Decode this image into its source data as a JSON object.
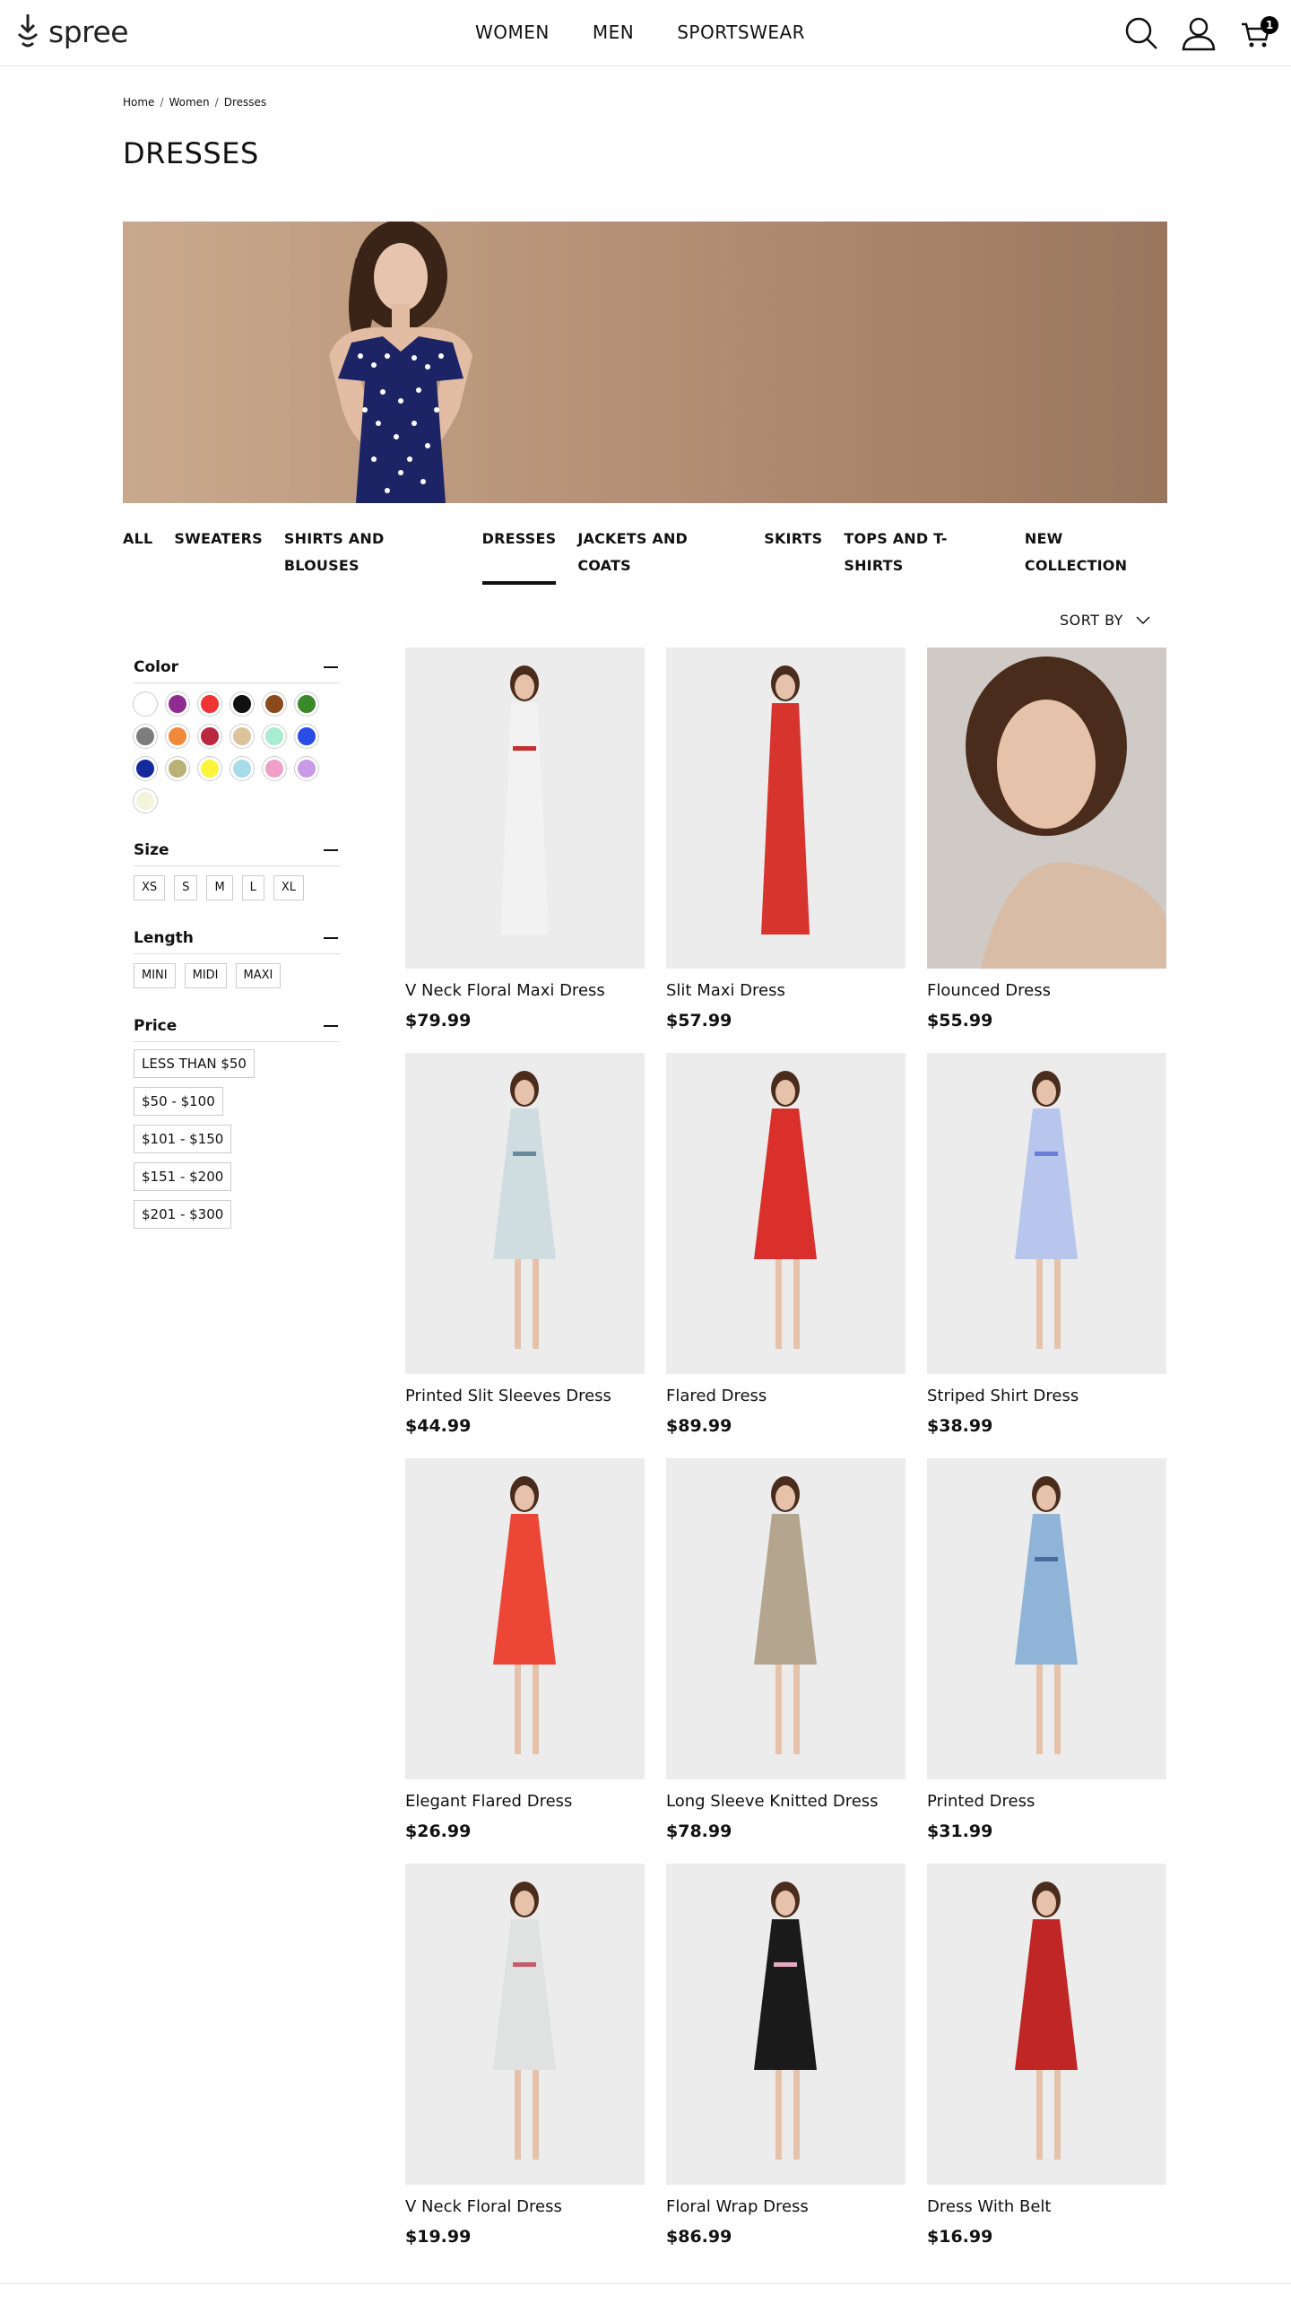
{
  "header": {
    "logo_text": "spree",
    "nav": [
      "WOMEN",
      "MEN",
      "SPORTSWEAR"
    ],
    "cart_count": "1",
    "icons": [
      "search-icon",
      "account-icon",
      "cart-icon"
    ]
  },
  "breadcrumb": [
    "Home",
    "Women",
    "Dresses"
  ],
  "page_title": "DRESSES",
  "categories": [
    "ALL",
    "SWEATERS",
    "SHIRTS AND BLOUSES",
    "DRESSES",
    "JACKETS AND COATS",
    "SKIRTS",
    "TOPS AND T-SHIRTS",
    "NEW COLLECTION"
  ],
  "active_category": "DRESSES",
  "sort_label": "SORT BY",
  "filters": {
    "color_title": "Color",
    "colors": [
      "#ffffff",
      "#8e2d8f",
      "#ee3434",
      "#111111",
      "#8a4a1c",
      "#3a8a2a",
      "#7d7d7d",
      "#f0893a",
      "#b8283e",
      "#dcc39b",
      "#a8ecd2",
      "#2a4ce6",
      "#142a9a",
      "#b9b277",
      "#fbf43a",
      "#a8dbe8",
      "#f0a0c8",
      "#c89ae8",
      "#f4f4dc"
    ],
    "size_title": "Size",
    "sizes": [
      "XS",
      "S",
      "M",
      "L",
      "XL"
    ],
    "length_title": "Length",
    "lengths": [
      "MINI",
      "MIDI",
      "MAXI"
    ],
    "price_title": "Price",
    "prices": [
      "LESS THAN $50",
      "$50 - $100",
      "$101 - $150",
      "$151 - $200",
      "$201 - $300"
    ]
  },
  "products": [
    {
      "name": "V Neck Floral Maxi Dress",
      "price": "$79.99",
      "dress": "#f2f2f2",
      "accent": "#c23030"
    },
    {
      "name": "Slit Maxi Dress",
      "price": "$57.99",
      "dress": "#d8342e",
      "accent": "#d8342e"
    },
    {
      "name": "Flounced Dress",
      "price": "$55.99",
      "dress": "#d8bca6",
      "accent": "#b89478"
    },
    {
      "name": "Printed Slit Sleeves Dress",
      "price": "$44.99",
      "dress": "#cfdce0",
      "accent": "#6a8a9a"
    },
    {
      "name": "Flared Dress",
      "price": "$89.99",
      "dress": "#d9302b",
      "accent": "#d9302b"
    },
    {
      "name": "Striped Shirt Dress",
      "price": "$38.99",
      "dress": "#b8c6ee",
      "accent": "#6a7ed8"
    },
    {
      "name": "Elegant Flared Dress",
      "price": "$26.99",
      "dress": "#ec4636",
      "accent": "#ec4636"
    },
    {
      "name": "Long Sleeve Knitted Dress",
      "price": "$78.99",
      "dress": "#b4a68e",
      "accent": "#b4a68e"
    },
    {
      "name": "Printed Dress",
      "price": "$31.99",
      "dress": "#8fb4d8",
      "accent": "#4a6a9a"
    },
    {
      "name": "V Neck Floral Dress",
      "price": "$19.99",
      "dress": "#dfe2e0",
      "accent": "#c85a6a"
    },
    {
      "name": "Floral Wrap Dress",
      "price": "$86.99",
      "dress": "#1a1a1a",
      "accent": "#e8a8c0"
    },
    {
      "name": "Dress With Belt",
      "price": "$16.99",
      "dress": "#c12626",
      "accent": "#c12626"
    }
  ]
}
